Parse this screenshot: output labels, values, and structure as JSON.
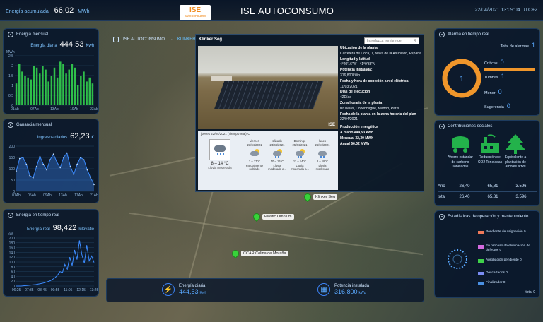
{
  "header": {
    "accum_label": "Energía acumulada",
    "accum_value": "66,02",
    "accum_unit": "MWh",
    "logo_main": "ISE",
    "logo_sub": "autoconsumo",
    "title": "ISE AUTOCONSUMO",
    "datetime": "22/04/2021 13:09:04 UTC+2"
  },
  "breadcrumb": {
    "root": "ISE AUTOCONSUMO",
    "sep": "→",
    "current": "KLINKER"
  },
  "energia_mensual": {
    "title": "Energía mensual",
    "kpi_label": "Energía diaria",
    "kpi_value": "444,53",
    "kpi_unit": "Kwh",
    "unit": "MWh",
    "y_ticks": [
      "2,5",
      "2",
      "1,5",
      "1",
      "0,5",
      "0"
    ],
    "x_ticks": [
      "01Ab",
      "07Ab",
      "13Ab",
      "19Ab",
      "23Ab"
    ],
    "values": [
      1.1,
      2.1,
      1.7,
      1.5,
      1.4,
      1.3,
      2.0,
      1.9,
      1.6,
      2.0,
      1.8,
      1.2,
      1.5,
      1.9,
      1.4,
      2.2,
      2.1,
      1.6,
      1.8,
      2.1,
      1.9,
      1.0,
      1.5,
      1.7,
      1.2,
      1.4,
      1.1
    ],
    "color": "#2fbf4a"
  },
  "ganancia_mensual": {
    "title": "Ganancia mensual",
    "kpi_label": "Ingresos diarios",
    "kpi_value": "62,23",
    "kpi_unit": "€",
    "y_ticks": [
      "200",
      "150",
      "100",
      "50",
      "0"
    ],
    "x_ticks": [
      "01Ab",
      "05Ab",
      "09Ab",
      "13Ab",
      "17Ab",
      "21Ab"
    ],
    "values": [
      90,
      145,
      150,
      120,
      70,
      60,
      110,
      155,
      120,
      95,
      140,
      165,
      130,
      105,
      150,
      170,
      110,
      75,
      120,
      150,
      140,
      95,
      60,
      30
    ],
    "color": "#3b8bff"
  },
  "energia_tiempo_real": {
    "title": "Energía en tiempo real",
    "kpi_label": "Energía real",
    "kpi_value": "98,422",
    "kpi_unit": "kilovatio",
    "unit": "kW",
    "y_ticks": [
      "200",
      "180",
      "160",
      "140",
      "120",
      "100",
      "80",
      "60",
      "40",
      "20",
      "0"
    ],
    "x_ticks": [
      "06:25",
      "07:35",
      "08:45",
      "09:55",
      "11:05",
      "12:15",
      "13:25"
    ],
    "values": [
      0,
      0,
      0,
      1,
      2,
      3,
      4,
      5,
      6,
      8,
      10,
      12,
      15,
      18,
      22,
      28,
      35,
      45,
      60,
      55,
      90,
      70,
      120,
      85,
      150,
      110,
      190,
      130,
      95,
      170,
      105,
      125,
      98
    ],
    "color": "#3b8bff"
  },
  "popup": {
    "plant_name": "Klinker Seg",
    "search_placeholder": "Introduzca nombre de",
    "photo_watermark": "ISE",
    "info": [
      {
        "label": "Ubicación de la planta:",
        "value": "Carretera de Coca, 1, Nava de la Asunción, España"
      },
      {
        "label": "Longitud y latitud",
        "value": "4°20'16\"W , 41°9'33\"N"
      },
      {
        "label": "Potencia instalada:",
        "value": "316,800kWp"
      },
      {
        "label": "Fecha y hora de conexión a red eléctrica:",
        "value": "11/03/2021"
      },
      {
        "label": "Días de ejecución",
        "value": "42Días"
      },
      {
        "label": "Zona horaria de la planta",
        "value": "Bruselas, Copenhague, Madrid, París"
      },
      {
        "label": "Fecha de la planta en la zona horaria del plan",
        "value": "22/04/2021"
      }
    ],
    "production_title": "Producción energética",
    "production": [
      "A diario 444,53 kWh",
      "Mensual 32,30 MWh",
      "Anual 66,02 MWh"
    ]
  },
  "weather": {
    "today_label": "jueves 22/04/2021 (Tiempo real)°C",
    "today_temp": "8 – 14 °C",
    "today_desc": "Lluvia moderada",
    "days": [
      {
        "day": "viernes",
        "date": "23/04/2021",
        "temp": "7 – 17°C",
        "desc": "Parcialmente nublado",
        "icon": "partly-cloudy"
      },
      {
        "day": "sábado",
        "date": "24/04/2021",
        "temp": "10 – 16°C",
        "desc": "Lluvia moderada a...",
        "icon": "rain-sun"
      },
      {
        "day": "Domingo",
        "date": "25/04/2021",
        "temp": "11 – 14°C",
        "desc": "Lluvia moderada a...",
        "icon": "rain-sun"
      },
      {
        "day": "lunes",
        "date": "26/04/2021",
        "temp": "8 – 18°C",
        "desc": "Lluvia moderada",
        "icon": "rain"
      }
    ]
  },
  "map_markers": [
    {
      "label": "Klinker Seg"
    },
    {
      "label": "Plastic Omnium"
    },
    {
      "label": "CCAR Colina de Moraña"
    }
  ],
  "bottom": {
    "energy_label": "Energía diaria",
    "energy_value": "444,53",
    "energy_unit": "Kwh",
    "power_label": "Potencia instalada",
    "power_value": "316,800",
    "power_unit": "kWp"
  },
  "alarm": {
    "title": "Alarma en tiempo real",
    "total_label": "Total de alarmas",
    "total_value": "1",
    "center_value": "1",
    "rows": [
      {
        "label": "Críticas",
        "value": "0"
      },
      {
        "label": "Tumbas",
        "value": "1"
      },
      {
        "label": "Menor",
        "value": "0"
      },
      {
        "label": "Sugerencia",
        "value": "0"
      }
    ],
    "accent": "#f0962b"
  },
  "social": {
    "title": "Contribuciones sociales",
    "items": [
      {
        "label": "Ahorro estándar de carbono Toneladas",
        "icon": "coal-cart-icon"
      },
      {
        "label": "Reducción del CO2 Toneladas",
        "icon": "factory-icon"
      },
      {
        "label": "Equivalente a plantación de árboles árbol",
        "icon": "tree-icon"
      }
    ],
    "table": [
      {
        "row": "Año",
        "c1": "26,40",
        "c2": "65,81",
        "c3": "3.596"
      },
      {
        "row": "total",
        "c1": "26,40",
        "c2": "65,81",
        "c3": "3.596"
      }
    ],
    "color": "#23b24b"
  },
  "ops": {
    "title": "Estadísticas de operación y mantenimiento",
    "legend": [
      {
        "label": "Pendiente de asignación 0",
        "color": "#f07a5a"
      },
      {
        "label": "En proceso de eliminación de defectos 0",
        "color": "#d46ae0"
      },
      {
        "label": "Aprobación pendiente 0",
        "color": "#3fd24a"
      },
      {
        "label": "Descartados 0",
        "color": "#7a8cf2"
      },
      {
        "label": "Finalizador 0",
        "color": "#4a90e2"
      }
    ],
    "total": "total 0"
  }
}
